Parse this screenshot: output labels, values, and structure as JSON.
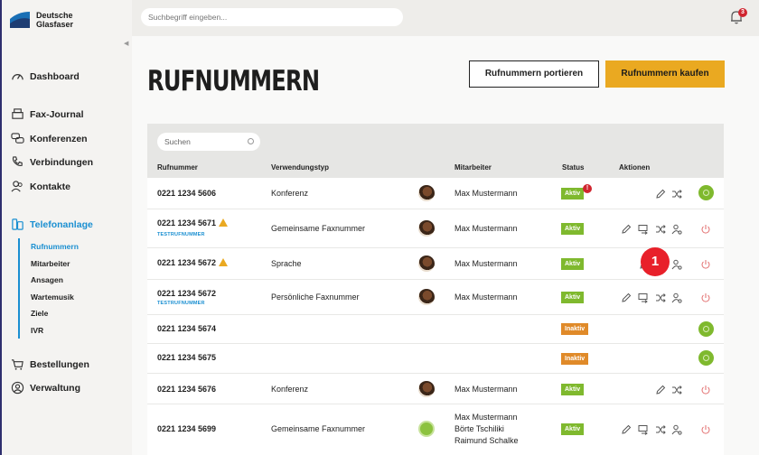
{
  "brand": {
    "line1": "Deutsche",
    "line2": "Glasfaser"
  },
  "search": {
    "placeholder": "Suchbegriff eingeben..."
  },
  "notifications": {
    "count": "3"
  },
  "nav": {
    "dashboard": "Dashboard",
    "fax": "Fax-Journal",
    "conferences": "Konferenzen",
    "connections": "Verbindungen",
    "contacts": "Kontakte",
    "phone_system": "Telefonanlage",
    "sub": [
      "Rufnummern",
      "Mitarbeiter",
      "Ansagen",
      "Wartemusik",
      "Ziele",
      "IVR"
    ],
    "orders": "Bestellungen",
    "admin": "Verwaltung"
  },
  "page": {
    "title": "RUFNUMMERN",
    "port_button": "Rufnummern portieren",
    "buy_button": "Rufnummern kaufen"
  },
  "table": {
    "search_placeholder": "Suchen",
    "columns": [
      "Rufnummer",
      "Verwendungstyp",
      "Mitarbeiter",
      "Status",
      "Aktionen"
    ],
    "rows": [
      {
        "number": "0221 1234 5606",
        "type": "Konferenz",
        "employee": "Max Mustermann",
        "status": "Aktiv",
        "toggle": "on"
      },
      {
        "number": "0221 1234 5671",
        "tag": "TESTRUFNUMMER",
        "type": "Gemeinsame Faxnummer",
        "employee": "Max Mustermann",
        "status": "Aktiv",
        "toggle": "off"
      },
      {
        "number": "0221 1234 5672",
        "type": "Sprache",
        "employee": "Max Mustermann",
        "status": "Aktiv",
        "toggle": "off"
      },
      {
        "number": "0221 1234 5672",
        "tag": "TESTRUFNUMMER",
        "type": "Persönliche Faxnummer",
        "employee": "Max Mustermann",
        "status": "Aktiv",
        "toggle": "off"
      },
      {
        "number": "0221 1234 5674",
        "type": "",
        "employee": "",
        "status": "Inaktiv",
        "toggle": "on"
      },
      {
        "number": "0221 1234 5675",
        "type": "",
        "employee": "",
        "status": "Inaktiv",
        "toggle": "on"
      },
      {
        "number": "0221 1234 5676",
        "type": "Konferenz",
        "employee": "Max Mustermann",
        "status": "Aktiv",
        "toggle": "off"
      },
      {
        "number": "0221 1234 5699",
        "type": "Gemeinsame Faxnummer",
        "employees": [
          "Max Mustermann",
          "Börte Tschiliki",
          "Raimund Schalke"
        ],
        "status": "Aktiv",
        "toggle": "off"
      }
    ],
    "status_alert": "!"
  },
  "step_marker": "1",
  "colors": {
    "accent": "#1a8fd1",
    "gold": "#eaa921",
    "active": "#7fb92e",
    "inactive": "#e08a29",
    "alert": "#d0252f"
  }
}
